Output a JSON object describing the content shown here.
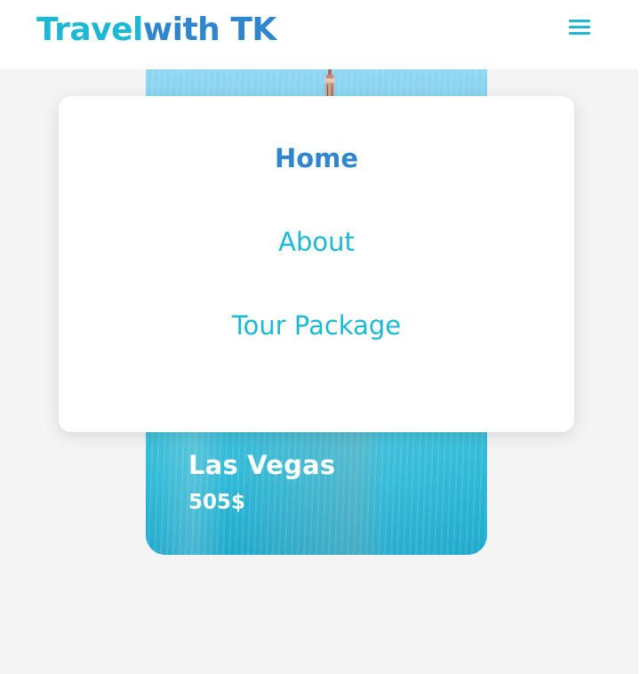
{
  "header": {
    "brand_part1": "Travel",
    "brand_part2": "with TK",
    "menu_icon": "hamburger-menu-icon"
  },
  "nav": {
    "items": [
      {
        "label": "Home",
        "active": true
      },
      {
        "label": "About",
        "active": false
      },
      {
        "label": "Tour Package",
        "active": false
      }
    ]
  },
  "card": {
    "title": "Las Vegas",
    "price": "505$"
  },
  "colors": {
    "accent_cyan": "#1db8d4",
    "accent_blue": "#2f86cc",
    "background": "#f4f4f4",
    "panel": "#ffffff"
  }
}
